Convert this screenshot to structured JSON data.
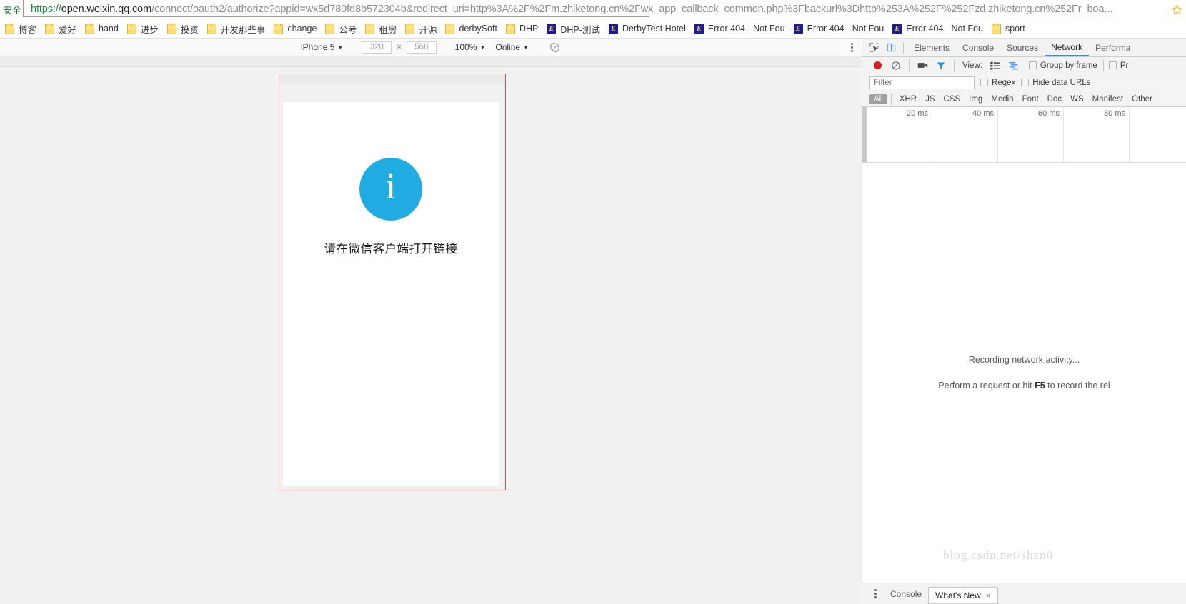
{
  "browser": {
    "security_label": "安全",
    "url_full": "https://open.weixin.qq.com/connect/oauth2/authorize?appid=wx5d780fd8b572304b&redirect_uri=http%3A%2F%2Fm.zhiketong.cn%2Fwx_app_callback_common.php%3Fbackurl%3Dhttp%253A%252F%252Fzd.zhiketong.cn%252Fr_boa...",
    "url_scheme": "https://",
    "url_host": "open.weixin.qq.com",
    "url_path": "/connect/oauth2/authorize?appid=wx5d780fd8b572304b&redirect_uri=http%3A%2F%2Fm.zhiketong.cn%2Fwx_app_callback_common.php%3Fbackurl%3Dhttp%253A%252F%252Fzd.zhiketong.cn%252Fr_boa...",
    "star_icon": "star-icon"
  },
  "bookmarks": [
    {
      "label": "博客",
      "icon": "folder"
    },
    {
      "label": "爱好",
      "icon": "folder"
    },
    {
      "label": "hand",
      "icon": "folder"
    },
    {
      "label": "进步",
      "icon": "folder"
    },
    {
      "label": "投资",
      "icon": "folder"
    },
    {
      "label": "开发那些事",
      "icon": "folder"
    },
    {
      "label": "change",
      "icon": "folder"
    },
    {
      "label": "公考",
      "icon": "folder"
    },
    {
      "label": "租房",
      "icon": "folder"
    },
    {
      "label": "开源",
      "icon": "folder"
    },
    {
      "label": "derbySoft",
      "icon": "folder"
    },
    {
      "label": "DHP",
      "icon": "folder"
    },
    {
      "label": "DHP-测试",
      "icon": "favicon"
    },
    {
      "label": "DerbyTest Hotel",
      "icon": "favicon"
    },
    {
      "label": "Error 404 - Not Fou",
      "icon": "favicon"
    },
    {
      "label": "Error 404 - Not Fou",
      "icon": "favicon"
    },
    {
      "label": "Error 404 - Not Fou",
      "icon": "favicon"
    },
    {
      "label": "sport",
      "icon": "folder"
    }
  ],
  "device_toolbar": {
    "device": "iPhone 5",
    "width": "320",
    "height": "568",
    "x_separator": "×",
    "zoom": "100%",
    "throttling": "Online",
    "rotate_icon": "rotate-device-icon",
    "menu_icon": "more-vertical-icon"
  },
  "viewport": {
    "info_icon": "info-circle-icon",
    "info_glyph": "i",
    "message": "请在微信客户端打开链接",
    "accent_color": "#20ace3",
    "frame_border_color": "#c8564a"
  },
  "devtools": {
    "inspect_icon": "inspect-element-icon",
    "device_toggle_icon": "toggle-device-toolbar-icon",
    "tabs": [
      {
        "label": "Elements",
        "active": false
      },
      {
        "label": "Console",
        "active": false
      },
      {
        "label": "Sources",
        "active": false
      },
      {
        "label": "Network",
        "active": true
      },
      {
        "label": "Performa",
        "active": false
      }
    ],
    "network_toolbar": {
      "record_icon": "record-button-icon",
      "clear_icon": "clear-network-icon",
      "capture_screenshots_icon": "camera-icon",
      "filter_icon": "filter-funnel-icon",
      "view_label": "View:",
      "view_list_icon": "list-view-icon",
      "view_waterfall_icon": "waterfall-view-icon",
      "group_by_frame": "Group by frame",
      "preserve_log": "Pr"
    },
    "filter_row": {
      "filter_placeholder": "Filter",
      "regex_label": "Regex",
      "hide_data_urls_label": "Hide data URLs"
    },
    "resource_types": [
      {
        "label": "All",
        "active": true
      },
      {
        "label": "XHR",
        "active": false
      },
      {
        "label": "JS",
        "active": false
      },
      {
        "label": "CSS",
        "active": false
      },
      {
        "label": "Img",
        "active": false
      },
      {
        "label": "Media",
        "active": false
      },
      {
        "label": "Font",
        "active": false
      },
      {
        "label": "Doc",
        "active": false
      },
      {
        "label": "WS",
        "active": false
      },
      {
        "label": "Manifest",
        "active": false
      },
      {
        "label": "Other",
        "active": false
      }
    ],
    "overview_ticks": [
      "20 ms",
      "40 ms",
      "60 ms",
      "80 ms"
    ],
    "empty_state": {
      "line1": "Recording network activity...",
      "line2_pre": "Perform a request or hit ",
      "line2_key": "F5",
      "line2_post": " to record the rel"
    },
    "drawer": {
      "menu_icon": "drawer-more-icon",
      "tabs": [
        {
          "label": "Console",
          "active": false,
          "closable": false
        },
        {
          "label": "What's New",
          "active": true,
          "closable": true
        }
      ],
      "close_glyph": "×"
    }
  },
  "watermark": "blog.csdn.net/shzn0"
}
